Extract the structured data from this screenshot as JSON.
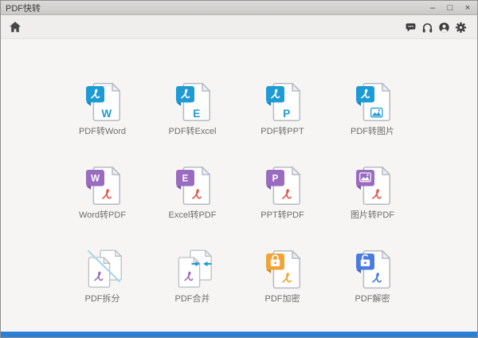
{
  "window": {
    "title": "PDF快转",
    "controls": {
      "minimize": "–",
      "maximize": "□",
      "close": "×"
    }
  },
  "toolbar": {
    "left_icons": [
      "home-icon"
    ],
    "right_icons": [
      "message-icon",
      "headset-icon",
      "account-icon",
      "gear-icon"
    ]
  },
  "grid": {
    "items": [
      {
        "label": "PDF转Word",
        "body_letter": "W"
      },
      {
        "label": "PDF转Excel",
        "body_letter": "E"
      },
      {
        "label": "PDF转PPT",
        "body_letter": "P"
      },
      {
        "label": "PDF转图片"
      },
      {
        "label": "Word转PDF",
        "banner_letter": "W"
      },
      {
        "label": "Excel转PDF",
        "banner_letter": "E"
      },
      {
        "label": "PPT转PDF",
        "banner_letter": "P"
      },
      {
        "label": "图片转PDF"
      },
      {
        "label": "PDF拆分"
      },
      {
        "label": "PDF合并"
      },
      {
        "label": "PDF加密"
      },
      {
        "label": "PDF解密"
      }
    ]
  },
  "colors": {
    "blue": "#1e9ad5",
    "blue_dark": "#1580b4",
    "purple": "#9a6cc0",
    "purple_dark": "#7b53a0",
    "red": "#e2574c",
    "orange": "#f0a437",
    "orange_dark": "#cd8320",
    "royal": "#4a7ce0",
    "royal_dark": "#3a63bf",
    "line_blue": "#aad5ee",
    "label_gray": "#6e6e6e",
    "bottom_bar": "#2b7fd5"
  }
}
